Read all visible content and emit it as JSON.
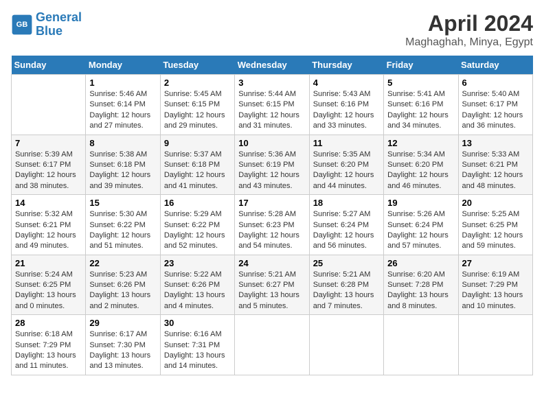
{
  "header": {
    "logo_line1": "General",
    "logo_line2": "Blue",
    "month_title": "April 2024",
    "location": "Maghaghah, Minya, Egypt"
  },
  "weekdays": [
    "Sunday",
    "Monday",
    "Tuesday",
    "Wednesday",
    "Thursday",
    "Friday",
    "Saturday"
  ],
  "weeks": [
    [
      {
        "day": "",
        "info": ""
      },
      {
        "day": "1",
        "info": "Sunrise: 5:46 AM\nSunset: 6:14 PM\nDaylight: 12 hours\nand 27 minutes."
      },
      {
        "day": "2",
        "info": "Sunrise: 5:45 AM\nSunset: 6:15 PM\nDaylight: 12 hours\nand 29 minutes."
      },
      {
        "day": "3",
        "info": "Sunrise: 5:44 AM\nSunset: 6:15 PM\nDaylight: 12 hours\nand 31 minutes."
      },
      {
        "day": "4",
        "info": "Sunrise: 5:43 AM\nSunset: 6:16 PM\nDaylight: 12 hours\nand 33 minutes."
      },
      {
        "day": "5",
        "info": "Sunrise: 5:41 AM\nSunset: 6:16 PM\nDaylight: 12 hours\nand 34 minutes."
      },
      {
        "day": "6",
        "info": "Sunrise: 5:40 AM\nSunset: 6:17 PM\nDaylight: 12 hours\nand 36 minutes."
      }
    ],
    [
      {
        "day": "7",
        "info": "Sunrise: 5:39 AM\nSunset: 6:17 PM\nDaylight: 12 hours\nand 38 minutes."
      },
      {
        "day": "8",
        "info": "Sunrise: 5:38 AM\nSunset: 6:18 PM\nDaylight: 12 hours\nand 39 minutes."
      },
      {
        "day": "9",
        "info": "Sunrise: 5:37 AM\nSunset: 6:18 PM\nDaylight: 12 hours\nand 41 minutes."
      },
      {
        "day": "10",
        "info": "Sunrise: 5:36 AM\nSunset: 6:19 PM\nDaylight: 12 hours\nand 43 minutes."
      },
      {
        "day": "11",
        "info": "Sunrise: 5:35 AM\nSunset: 6:20 PM\nDaylight: 12 hours\nand 44 minutes."
      },
      {
        "day": "12",
        "info": "Sunrise: 5:34 AM\nSunset: 6:20 PM\nDaylight: 12 hours\nand 46 minutes."
      },
      {
        "day": "13",
        "info": "Sunrise: 5:33 AM\nSunset: 6:21 PM\nDaylight: 12 hours\nand 48 minutes."
      }
    ],
    [
      {
        "day": "14",
        "info": "Sunrise: 5:32 AM\nSunset: 6:21 PM\nDaylight: 12 hours\nand 49 minutes."
      },
      {
        "day": "15",
        "info": "Sunrise: 5:30 AM\nSunset: 6:22 PM\nDaylight: 12 hours\nand 51 minutes."
      },
      {
        "day": "16",
        "info": "Sunrise: 5:29 AM\nSunset: 6:22 PM\nDaylight: 12 hours\nand 52 minutes."
      },
      {
        "day": "17",
        "info": "Sunrise: 5:28 AM\nSunset: 6:23 PM\nDaylight: 12 hours\nand 54 minutes."
      },
      {
        "day": "18",
        "info": "Sunrise: 5:27 AM\nSunset: 6:24 PM\nDaylight: 12 hours\nand 56 minutes."
      },
      {
        "day": "19",
        "info": "Sunrise: 5:26 AM\nSunset: 6:24 PM\nDaylight: 12 hours\nand 57 minutes."
      },
      {
        "day": "20",
        "info": "Sunrise: 5:25 AM\nSunset: 6:25 PM\nDaylight: 12 hours\nand 59 minutes."
      }
    ],
    [
      {
        "day": "21",
        "info": "Sunrise: 5:24 AM\nSunset: 6:25 PM\nDaylight: 13 hours\nand 0 minutes."
      },
      {
        "day": "22",
        "info": "Sunrise: 5:23 AM\nSunset: 6:26 PM\nDaylight: 13 hours\nand 2 minutes."
      },
      {
        "day": "23",
        "info": "Sunrise: 5:22 AM\nSunset: 6:26 PM\nDaylight: 13 hours\nand 4 minutes."
      },
      {
        "day": "24",
        "info": "Sunrise: 5:21 AM\nSunset: 6:27 PM\nDaylight: 13 hours\nand 5 minutes."
      },
      {
        "day": "25",
        "info": "Sunrise: 5:21 AM\nSunset: 6:28 PM\nDaylight: 13 hours\nand 7 minutes."
      },
      {
        "day": "26",
        "info": "Sunrise: 6:20 AM\nSunset: 7:28 PM\nDaylight: 13 hours\nand 8 minutes."
      },
      {
        "day": "27",
        "info": "Sunrise: 6:19 AM\nSunset: 7:29 PM\nDaylight: 13 hours\nand 10 minutes."
      }
    ],
    [
      {
        "day": "28",
        "info": "Sunrise: 6:18 AM\nSunset: 7:29 PM\nDaylight: 13 hours\nand 11 minutes."
      },
      {
        "day": "29",
        "info": "Sunrise: 6:17 AM\nSunset: 7:30 PM\nDaylight: 13 hours\nand 13 minutes."
      },
      {
        "day": "30",
        "info": "Sunrise: 6:16 AM\nSunset: 7:31 PM\nDaylight: 13 hours\nand 14 minutes."
      },
      {
        "day": "",
        "info": ""
      },
      {
        "day": "",
        "info": ""
      },
      {
        "day": "",
        "info": ""
      },
      {
        "day": "",
        "info": ""
      }
    ]
  ]
}
